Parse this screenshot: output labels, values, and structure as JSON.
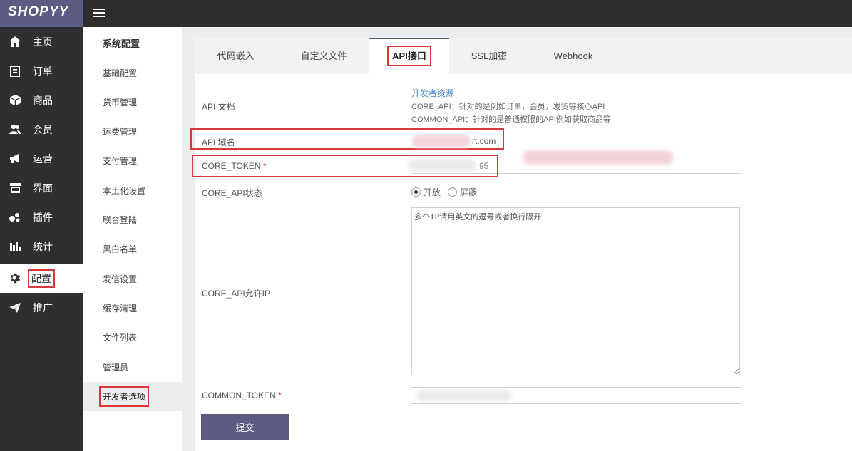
{
  "app": {
    "logo": "SHOPYY"
  },
  "nav": {
    "items": [
      {
        "label": "主页",
        "icon": "home-icon"
      },
      {
        "label": "订单",
        "icon": "order-icon"
      },
      {
        "label": "商品",
        "icon": "box-icon"
      },
      {
        "label": "会员",
        "icon": "users-icon"
      },
      {
        "label": "运营",
        "icon": "megaphone-icon"
      },
      {
        "label": "界面",
        "icon": "storefront-icon"
      },
      {
        "label": "插件",
        "icon": "plugin-icon"
      },
      {
        "label": "统计",
        "icon": "bar-chart-icon"
      },
      {
        "label": "配置",
        "icon": "gear-icon"
      },
      {
        "label": "推广",
        "icon": "paper-plane-icon"
      }
    ],
    "active": "配置"
  },
  "subnav": {
    "header": "系统配置",
    "items": [
      "基础配置",
      "货币管理",
      "运费管理",
      "支付管理",
      "本土化设置",
      "联合登陆",
      "黑白名单",
      "发信设置",
      "缓存清理",
      "文件列表",
      "管理员",
      "开发者选项"
    ],
    "active": "开发者选项"
  },
  "tabs": {
    "items": [
      "代码嵌入",
      "自定义文件",
      "API接口",
      "SSL加密",
      "Webhook"
    ],
    "active": "API接口"
  },
  "form": {
    "api_doc_label": "API 文档",
    "dev_link": "开发者资源",
    "core_note": "CORE_API：针对的是例如订单，会员，发货等核心API",
    "common_note": "COMMON_API：针对的是普通权限的API例如获取商品等",
    "domain_label": "API 域名",
    "domain_value_suffix": "rt.com",
    "core_token_label": "CORE_TOKEN",
    "core_token_suffix": "95",
    "required_mark": "*",
    "status_label": "CORE_API状态",
    "status_open": "开放",
    "status_block": "屏蔽",
    "allowed_ip_label": "CORE_API允许IP",
    "allowed_ip_placeholder": "多个IP请用英文的逗号或者换行隔开",
    "common_token_label": "COMMON_TOKEN",
    "submit": "提交"
  },
  "colors": {
    "brand": "#5b5b84",
    "highlight": "#d8383a",
    "link": "#3c7ebf"
  }
}
